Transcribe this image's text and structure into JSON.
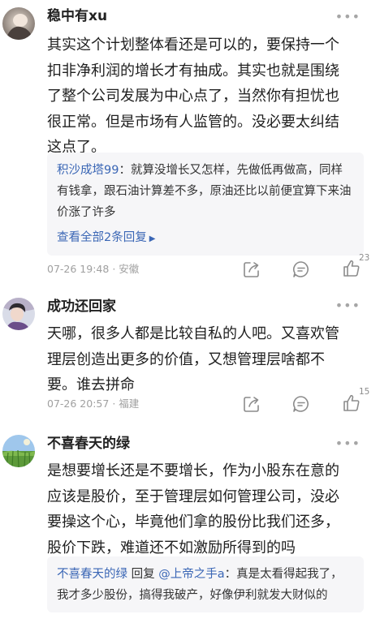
{
  "comments": [
    {
      "username": "稳中有xu",
      "text_lines": [
        "其实这个计划整体看还是可以的，要保持一个",
        "扣非净利润的增长才有抽成。其实也就是围绕",
        "了整个公司发展为中心点了，当然你有担忧也",
        "很正常。但是市场有人监管的。没必要太纠结",
        "这点了。"
      ],
      "reply": {
        "user": "积沙成塔99",
        "sep": "：",
        "text": "就算没增长又怎样，先做低再做高，同样有钱拿，跟石油计算差不多，原油还比以前便宜算下来油价涨了许多"
      },
      "view_replies": "查看全部2条回复",
      "time": "07-26 19:48",
      "location": "安徽",
      "like_count": "23"
    },
    {
      "username": "成功还回家",
      "text_lines": [
        "天哪，很多人都是比较自私的人吧。又喜欢管",
        "理层创造出更多的价值，又想管理层啥都不",
        "要。谁去拼命"
      ],
      "time": "07-26 20:57",
      "location": "福建",
      "like_count": "15"
    },
    {
      "username": "不喜春天的绿",
      "text_lines": [
        "是想要增长还是不要增长，作为小股东在意的",
        "应该是股价，至于管理层如何管理公司，没必",
        "要操这个心，毕竟他们拿的股份比我们还多，",
        "股价下跌，难道还不如激励所得到的吗"
      ],
      "reply": {
        "user": "不喜春天的绿",
        "mid": " 回复 ",
        "mention": "@上帝之手a",
        "sep": "：",
        "text": "真是太看得起我了，我才多少股份，搞得我破产，好像伊利就发大财似的"
      }
    }
  ],
  "dot_separator": "·",
  "more_glyph": "•••",
  "colors": {
    "link": "#3a66b5",
    "meta": "#a0a0a0",
    "reply_bg": "#f6f6f8"
  }
}
